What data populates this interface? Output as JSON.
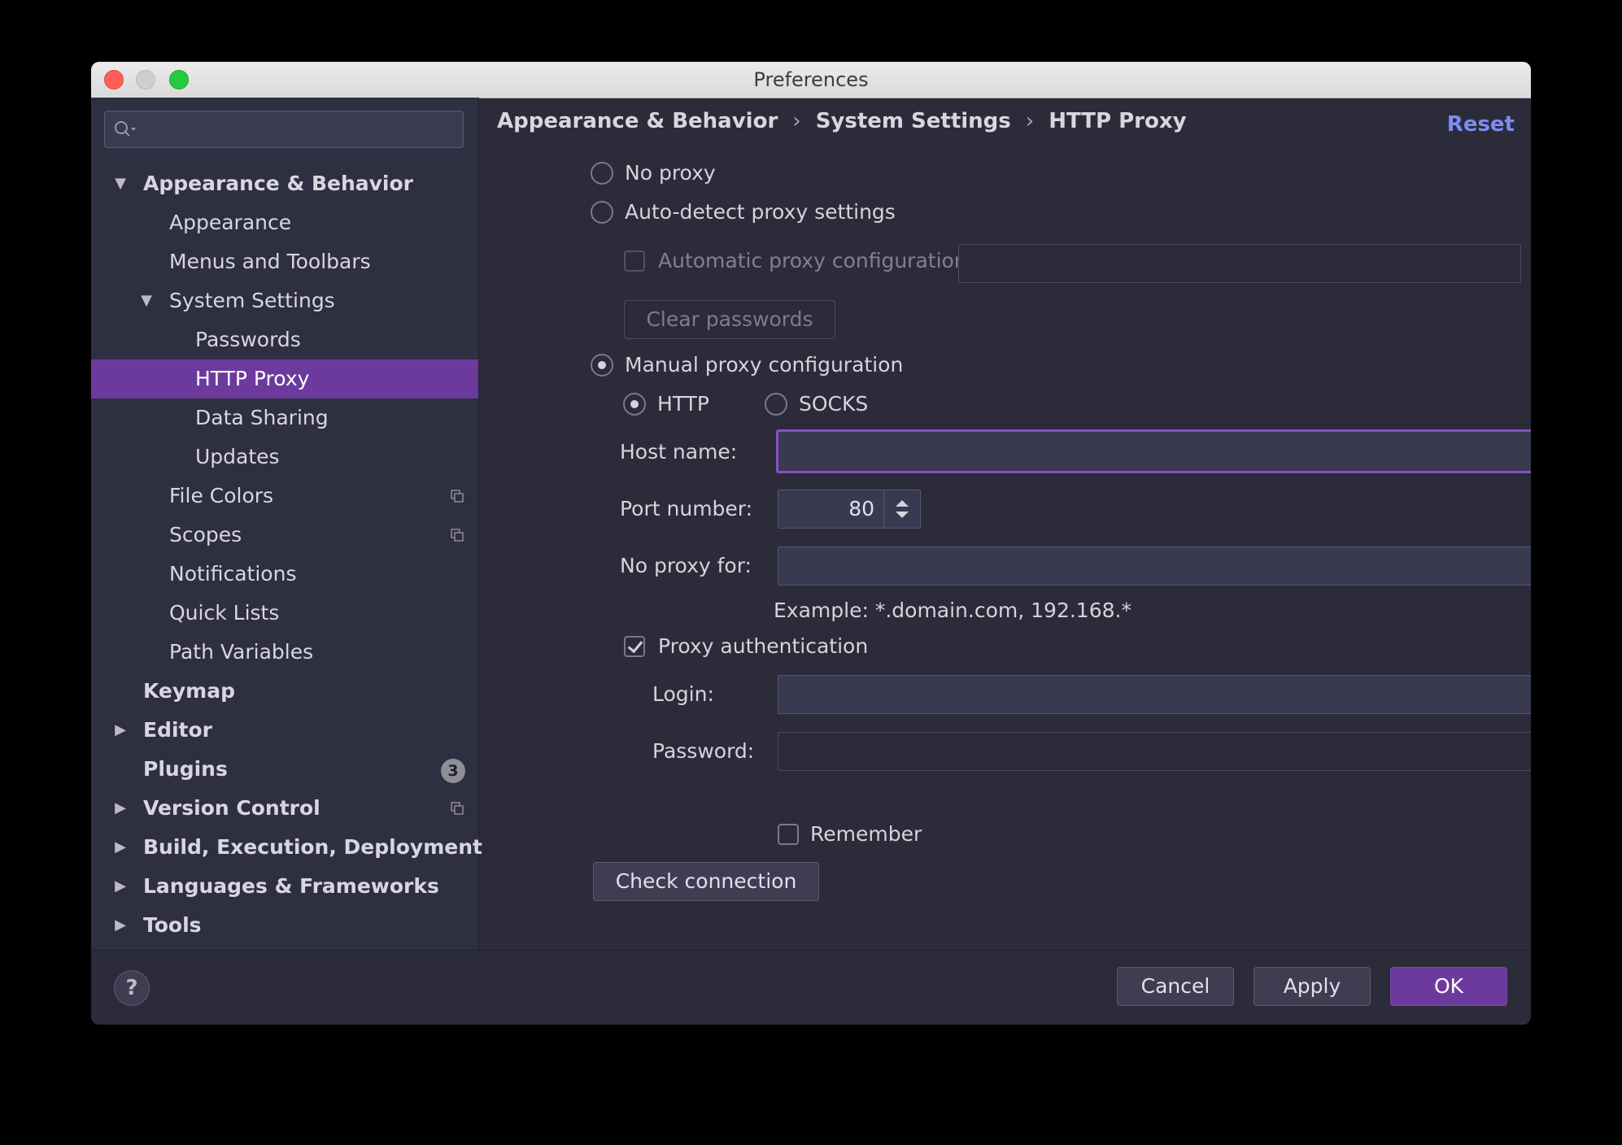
{
  "window": {
    "title": "Preferences"
  },
  "sidebar": {
    "search": {
      "placeholder": ""
    },
    "items": [
      {
        "label": "Appearance & Behavior",
        "expanded": true
      },
      {
        "label": "Appearance"
      },
      {
        "label": "Menus and Toolbars"
      },
      {
        "label": "System Settings",
        "expanded": true
      },
      {
        "label": "Passwords"
      },
      {
        "label": "HTTP Proxy",
        "selected": true
      },
      {
        "label": "Data Sharing"
      },
      {
        "label": "Updates"
      },
      {
        "label": "File Colors"
      },
      {
        "label": "Scopes"
      },
      {
        "label": "Notifications"
      },
      {
        "label": "Quick Lists"
      },
      {
        "label": "Path Variables"
      },
      {
        "label": "Keymap"
      },
      {
        "label": "Editor",
        "expanded": false
      },
      {
        "label": "Plugins",
        "badge": "3"
      },
      {
        "label": "Version Control",
        "expanded": false
      },
      {
        "label": "Build, Execution, Deployment",
        "expanded": false
      },
      {
        "label": "Languages & Frameworks",
        "expanded": false
      },
      {
        "label": "Tools",
        "expanded": false
      }
    ]
  },
  "breadcrumb": [
    "Appearance & Behavior",
    "System Settings",
    "HTTP Proxy"
  ],
  "breadcrumb_separator": "›",
  "reset_label": "Reset",
  "proxy": {
    "no_proxy": "No proxy",
    "auto_detect": "Auto-detect proxy settings",
    "auto_config_url_label": "Automatic proxy configuration URL:",
    "auto_config_url_value": "",
    "clear_passwords": "Clear passwords",
    "manual": "Manual proxy configuration",
    "selected_mode": "manual",
    "http": "HTTP",
    "socks": "SOCKS",
    "selected_protocol": "http",
    "host_label": "Host name:",
    "host_value": "",
    "port_label": "Port number:",
    "port_value": "80",
    "no_proxy_for_label": "No proxy for:",
    "no_proxy_for_value": "",
    "example": "Example: *.domain.com, 192.168.*",
    "proxy_auth": "Proxy authentication",
    "proxy_auth_checked": true,
    "login_label": "Login:",
    "login_value": "",
    "password_label": "Password:",
    "password_value": "",
    "remember": "Remember",
    "remember_checked": false,
    "check_connection": "Check connection"
  },
  "footer": {
    "help": "?",
    "cancel": "Cancel",
    "apply": "Apply",
    "ok": "OK"
  },
  "icons": {
    "search": "search-icon",
    "expand": "expand-icon",
    "copy": "copy-icon",
    "help": "help-icon"
  },
  "colors": {
    "accent": "#6c3a9c",
    "link": "#7b8cf2",
    "background": "#2b2b3a",
    "sidebar": "#2f2f42"
  }
}
